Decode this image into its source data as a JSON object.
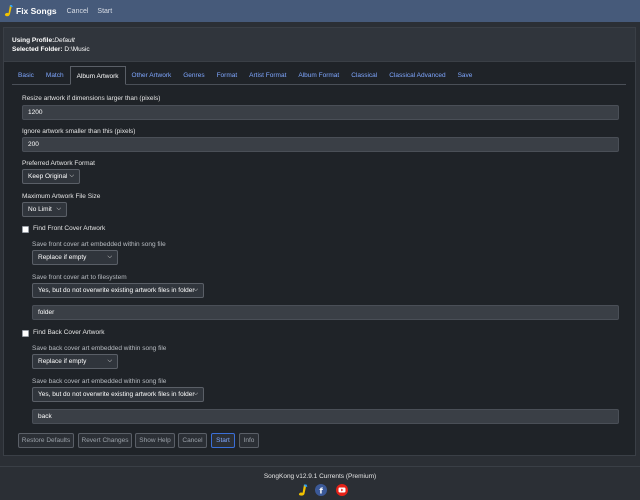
{
  "app": {
    "title": "Fix Songs"
  },
  "topnav": {
    "cancel": "Cancel",
    "start": "Start"
  },
  "profile": {
    "using_label": "Using Profile:",
    "using_value": "Default",
    "folder_label": "Selected Folder:",
    "folder_value": "D:\\Music"
  },
  "tabs": [
    {
      "label": "Basic",
      "active": false
    },
    {
      "label": "Match",
      "active": false
    },
    {
      "label": "Album Artwork",
      "active": true
    },
    {
      "label": "Other Artwork",
      "active": false
    },
    {
      "label": "Genres",
      "active": false
    },
    {
      "label": "Format",
      "active": false
    },
    {
      "label": "Artist Format",
      "active": false
    },
    {
      "label": "Album Format",
      "active": false
    },
    {
      "label": "Classical",
      "active": false
    },
    {
      "label": "Classical Advanced",
      "active": false
    },
    {
      "label": "Save",
      "active": false
    }
  ],
  "form": {
    "resize_label": "Resize artwork if dimensions larger than (pixels)",
    "resize_value": "1200",
    "ignore_label": "Ignore artwork smaller than this (pixels)",
    "ignore_value": "200",
    "format_label": "Preferred Artwork Format",
    "format_value": "Keep Original",
    "maxsize_label": "Maximum Artwork File Size",
    "maxsize_value": "No Limit",
    "front_check_label": "Find Front Cover Artwork",
    "front_embed_label": "Save front cover art embedded within song file",
    "front_embed_value": "Replace if empty",
    "front_fs_label": "Save front cover art to filesystem",
    "front_fs_value": "Yes, but do not overwrite existing artwork files in folder",
    "front_name_value": "folder",
    "back_check_label": "Find Back Cover Artwork",
    "back_embed_label": "Save back cover art embedded within song file",
    "back_embed_value": "Replace if empty",
    "back_fs_label": "Save back cover art embedded within song file",
    "back_fs_value": "Yes, but do not overwrite existing artwork files in folder",
    "back_name_value": "back"
  },
  "buttons": {
    "restore": "Restore Defaults",
    "revert": "Revert Changes",
    "help": "Show Help",
    "cancel": "Cancel",
    "start": "Start",
    "info": "Info"
  },
  "footer": {
    "version": "SongKong v12.9.1 Currents (Premium)"
  },
  "social_icons": [
    "songkong-logo-icon",
    "facebook-icon",
    "youtube-icon"
  ],
  "colors": {
    "topbar": "#465a7a",
    "link": "#7fa7ff",
    "primary_border": "#3b6fd8",
    "facebook": "#3b5998",
    "youtube": "#e62117"
  }
}
